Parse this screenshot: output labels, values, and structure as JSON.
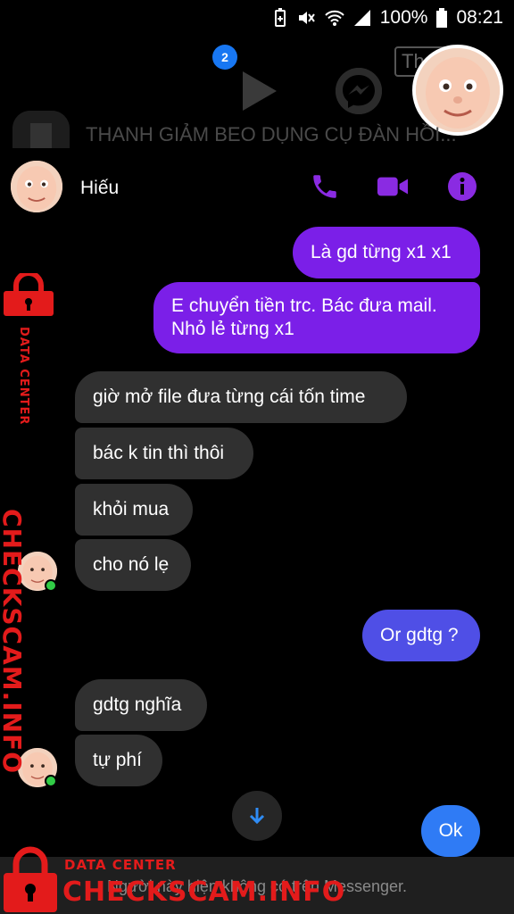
{
  "status_bar": {
    "battery": "100%",
    "time": "08:21"
  },
  "chat_heads": {
    "badge_count": "2",
    "shop_chip_text": "Th",
    "previous_chat_title": "THANH GIẢM BEO DỤNG CỤ ĐÀN HỒI..."
  },
  "header": {
    "name": "Hiếu",
    "icons": [
      "phone-icon",
      "video-camera-icon",
      "info-icon"
    ],
    "accent": "#8a2be2"
  },
  "messages": [
    {
      "side": "out",
      "text": "Là gd từng x1 x1"
    },
    {
      "side": "out",
      "text": "E chuyển tiền trc. Bác đưa mail."
    },
    {
      "side": "out",
      "text": "Nhỏ lẻ từng x1"
    },
    {
      "side": "in",
      "text": "giờ mở file đưa từng cái tốn time"
    },
    {
      "side": "in",
      "text": "bác k tin thì thôi"
    },
    {
      "side": "in",
      "text": "khỏi mua"
    },
    {
      "side": "in",
      "text": "cho nó lẹ"
    },
    {
      "side": "out",
      "text": "Or gdtg ?"
    },
    {
      "side": "in",
      "text": "gdtg nghĩa"
    },
    {
      "side": "in",
      "text": "tự phí"
    },
    {
      "side": "out",
      "text": "Ok"
    }
  ],
  "footer": {
    "notice": "Người này hiện không có trên Messenger."
  },
  "watermark": {
    "vertical_small": "DATA CENTER",
    "vertical_big": "CHECKSCAM.INFO",
    "bottom_small": "DATA CENTER",
    "bottom_big": "CHECKSCAM.INFO",
    "color": "#e31b1b"
  }
}
